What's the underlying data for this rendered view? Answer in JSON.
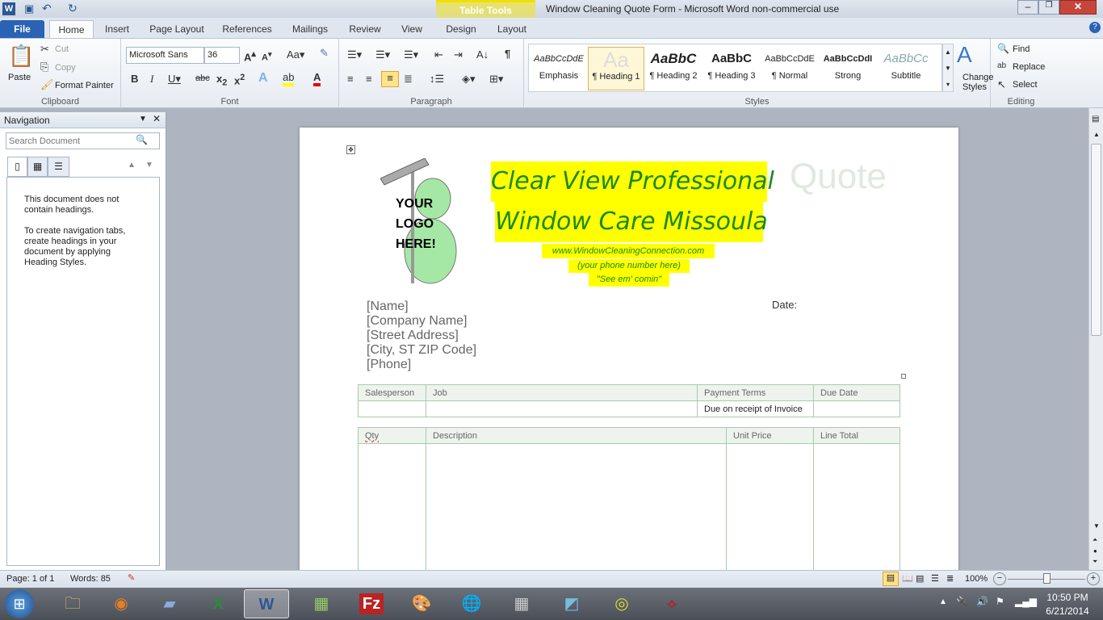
{
  "window": {
    "title": "Window Cleaning Quote Form  -  Microsoft Word non-commercial use",
    "contextual_tab": "Table Tools"
  },
  "tabs": [
    "File",
    "Home",
    "Insert",
    "Page Layout",
    "References",
    "Mailings",
    "Review",
    "View",
    "Design",
    "Layout"
  ],
  "clipboard": {
    "paste": "Paste",
    "cut": "Cut",
    "copy": "Copy",
    "format_painter": "Format Painter",
    "label": "Clipboard"
  },
  "font": {
    "name": "Microsoft Sans",
    "size": "36",
    "label": "Font"
  },
  "paragraph": {
    "label": "Paragraph"
  },
  "styles": {
    "label": "Styles",
    "items": [
      {
        "preview": "AaBbCcDdE",
        "name": "Emphasis"
      },
      {
        "preview": "Aa",
        "name": "¶ Heading 1"
      },
      {
        "preview": "AaBbC",
        "name": "¶ Heading 2"
      },
      {
        "preview": "AaBbC",
        "name": "¶ Heading 3"
      },
      {
        "preview": "AaBbCcDdE",
        "name": "¶ Normal"
      },
      {
        "preview": "AaBbCcDdI",
        "name": "Strong"
      },
      {
        "preview": "AaBbCc",
        "name": "Subtitle"
      }
    ],
    "change": "Change Styles"
  },
  "editing": {
    "label": "Editing",
    "find": "Find",
    "replace": "Replace",
    "select": "Select"
  },
  "navigation": {
    "title": "Navigation",
    "search_placeholder": "Search Document",
    "msg1": "This document does not contain headings.",
    "msg2": "To create navigation tabs, create headings in your document by applying Heading Styles."
  },
  "document": {
    "logo": {
      "line1": "YOUR",
      "line2": "LOGO",
      "line3": "HERE!"
    },
    "company1": "Clear View Professional",
    "company2": "Window Care Missoula",
    "website": "www.WindowCleaningConnection.com",
    "phone": "(your phone number here)",
    "slogan": "\"See em' comin\"",
    "doc_title": "Quote",
    "date_label": "Date:",
    "address": [
      "[Name]",
      "[Company Name]",
      "[Street Address]",
      "[City, ST  ZIP Code]",
      "[Phone]"
    ],
    "table1": {
      "headers": [
        "Salesperson",
        "Job",
        "Payment Terms",
        "Due Date"
      ],
      "row": [
        "",
        "",
        "Due on receipt of Invoice",
        ""
      ]
    },
    "table2": {
      "headers": [
        "Qty",
        "Description",
        "Unit Price",
        "Line Total"
      ]
    }
  },
  "status": {
    "page": "Page: 1 of 1",
    "words": "Words: 85",
    "zoom": "100%",
    "zoom_level": 100
  },
  "taskbar": {
    "time": "10:50 PM",
    "date": "6/21/2014"
  },
  "colors": {
    "highlight": "#ffff00",
    "green_text": "#1a8a1a",
    "quote_title": "#dfe9df",
    "table_border": "#a8ccad"
  }
}
